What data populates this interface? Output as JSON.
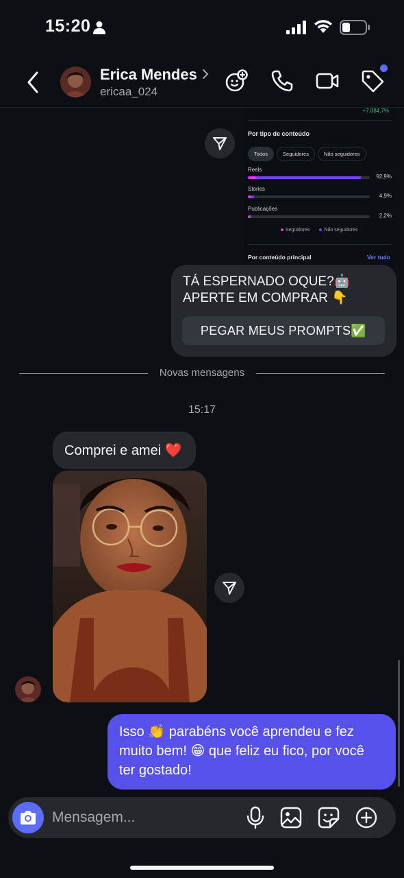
{
  "status_bar": {
    "time": "15:20"
  },
  "header": {
    "name": "Erica Mendes",
    "handle": "ericaa_024"
  },
  "insights": {
    "growth": "+7.084,7%",
    "section_title": "Por tipo de conteúdo",
    "filters": [
      "Todos",
      "Seguidores",
      "Não seguidores"
    ],
    "metrics": [
      {
        "label": "Reels",
        "percent": "92,9%",
        "followers_fraction": 0.07,
        "value_fraction": 0.929
      },
      {
        "label": "Stories",
        "percent": "4,9%",
        "followers_fraction": 0.02,
        "value_fraction": 0.049
      },
      {
        "label": "Publicações",
        "percent": "2,2%",
        "followers_fraction": 0.01,
        "value_fraction": 0.022
      }
    ],
    "legend": [
      "Seguidores",
      "Não seguidores"
    ],
    "main_title": "Por conteúdo principal",
    "see_all": "Ver tudo",
    "colors": {
      "followers": "#d63be0",
      "non_followers": "#7b3cf0"
    }
  },
  "messages": {
    "promo_text": "TÁ ESPERNADO OQUE?🤖\nAPERTE EM COMPRAR 👇",
    "promo_button": "PEGAR MEUS PROMPTS✅",
    "new_messages_label": "Novas mensagens",
    "timestamp": "15:17",
    "incoming_text": "Comprei e amei ❤️",
    "outgoing_text": "Isso 👏 parabéns você aprendeu e fez muito bem! 😁 que feliz eu fico, por você ter gostado!"
  },
  "composer": {
    "placeholder": "Mensagem..."
  },
  "colors": {
    "background": "#0c1014",
    "accent": "#5b6cff",
    "outgoing_bubble": "#5851e9",
    "incoming_bubble": "#25292e"
  }
}
